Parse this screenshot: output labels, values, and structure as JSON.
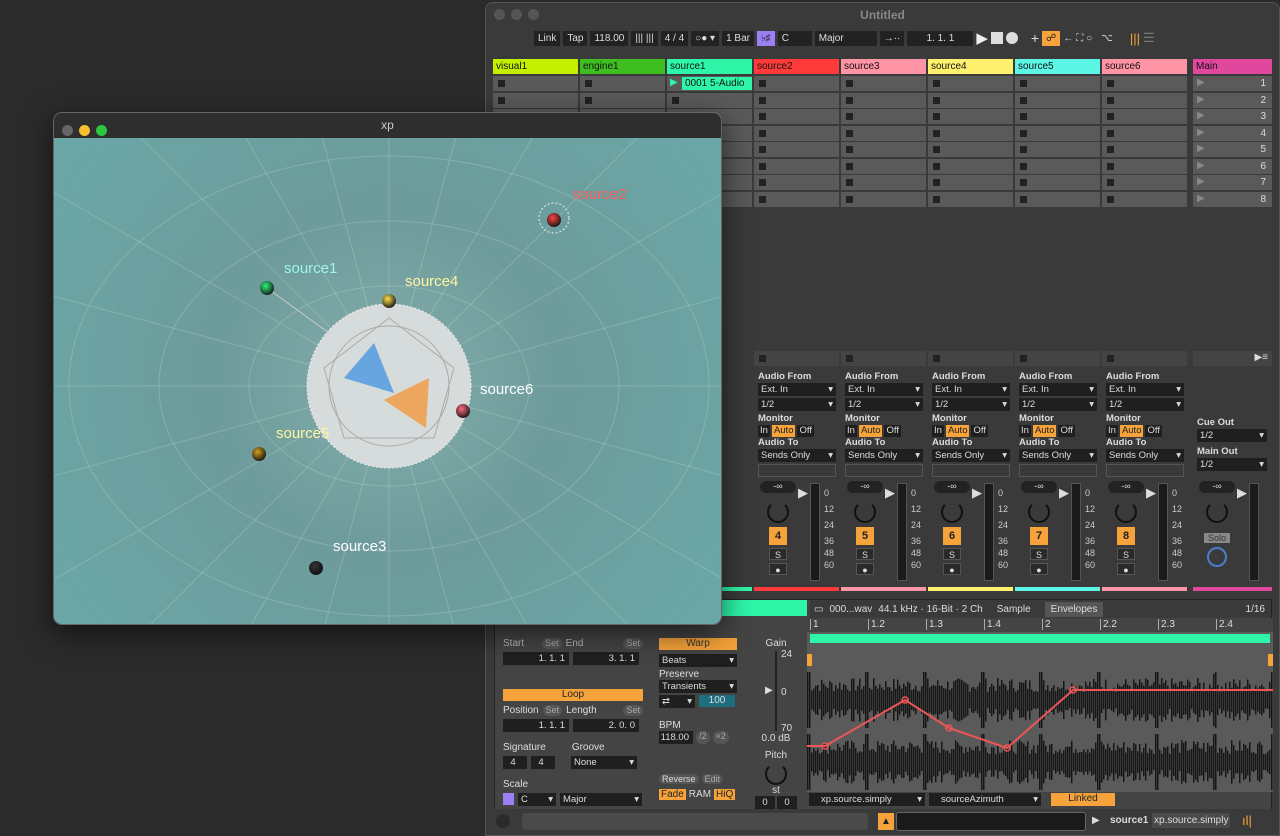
{
  "live": {
    "title": "Untitled",
    "toolbar": {
      "link": "Link",
      "tap": "Tap",
      "tempo": "118.00",
      "signature": "4 / 4",
      "quantize": "1 Bar",
      "key": "C",
      "scale": "Major",
      "position": "1.  1.  1"
    },
    "tracks": [
      {
        "name": "visual1",
        "color": "#c4f000"
      },
      {
        "name": "engine1",
        "color": "#3fbf1f"
      },
      {
        "name": "source1",
        "color": "#2ef5a8",
        "clip": "0001 5-Audio"
      },
      {
        "name": "source2",
        "color": "#ff3a3a",
        "num": "4"
      },
      {
        "name": "source3",
        "color": "#ff94a6",
        "num": "5"
      },
      {
        "name": "source4",
        "color": "#fff06e",
        "num": "6"
      },
      {
        "name": "source5",
        "color": "#5cf5e6",
        "num": "7"
      },
      {
        "name": "source6",
        "color": "#ff94a6",
        "num": "8"
      }
    ],
    "main": {
      "name": "Main",
      "color": "#e0489e",
      "scenes": [
        "1",
        "2",
        "3",
        "4",
        "5",
        "6",
        "7",
        "8"
      ],
      "cue_out_label": "Cue Out",
      "cue_out": "1/2",
      "main_out_label": "Main Out",
      "main_out": "1/2",
      "solo": "Solo",
      "vol": "-∞"
    },
    "io": {
      "audio_from": "Audio From",
      "ext_in": "Ext. In",
      "channel": "1/2",
      "monitor": "Monitor",
      "in": "In",
      "auto": "Auto",
      "off": "Off",
      "audio_to": "Audio To",
      "sends_only": "Sends Only",
      "vol": "-∞",
      "solo": "S",
      "meter_scale": [
        "0",
        "12",
        "24",
        "36",
        "48",
        "60"
      ]
    },
    "clip": {
      "file": "000...wav",
      "info": "44.1 kHz · 16-Bit · 2 Ch",
      "tab_sample": "Sample",
      "tab_envelopes": "Envelopes",
      "grid": "1/16",
      "ruler": [
        "1",
        "1.2",
        "1.3",
        "1.4",
        "2",
        "2.2",
        "2.3",
        "2.4"
      ],
      "start_label": "Start",
      "end_label": "End",
      "set": "Set",
      "start": "1.  1.  1",
      "end": "3.  1.  1",
      "loop": "Loop",
      "position_label": "Position",
      "length_label": "Length",
      "position": "1.  1.  1",
      "length": "2.  0.  0",
      "signature_label": "Signature",
      "sig_num": "4",
      "sig_den": "4",
      "groove_label": "Groove",
      "groove": "None",
      "scale_label": "Scale",
      "scale_key": "C",
      "scale_mode": "Major",
      "warp": "Warp",
      "warp_mode": "Beats",
      "preserve_label": "Preserve",
      "preserve": "Transients",
      "envelope_value": "100",
      "bpm_label": "BPM",
      "bpm": "118.00",
      "half": "/2",
      "double": "×2",
      "reverse": "Reverse",
      "edit": "Edit",
      "fade": "Fade",
      "ram": "RAM",
      "hiq": "HiQ",
      "gain_label": "Gain",
      "gain_max": "24",
      "gain_mid": "0",
      "gain_min": "70",
      "gain_value": "0.0 dB",
      "pitch_label": "Pitch",
      "pitch_unit": "st",
      "pitch_semi": "0",
      "pitch_cent": "0",
      "env_device": "xp.source.simply",
      "env_param": "sourceAzimuth",
      "linked": "Linked"
    },
    "status": {
      "track": "source1",
      "device": "xp.source.simply"
    }
  },
  "xp": {
    "title": "xp",
    "sources": [
      {
        "name": "source1",
        "color": "#9ef5ee",
        "ball": "#2ef57a"
      },
      {
        "name": "source2",
        "color": "#ff5a5a",
        "ball": "#ff4444"
      },
      {
        "name": "source3",
        "color": "#ffffff",
        "ball": "#333"
      },
      {
        "name": "source4",
        "color": "#fff6a0",
        "ball": "#ffe04a"
      },
      {
        "name": "source5",
        "color": "#fff6a0",
        "ball": "#d4a020"
      },
      {
        "name": "source6",
        "color": "#ffffff",
        "ball": "#ff6a80"
      }
    ]
  }
}
